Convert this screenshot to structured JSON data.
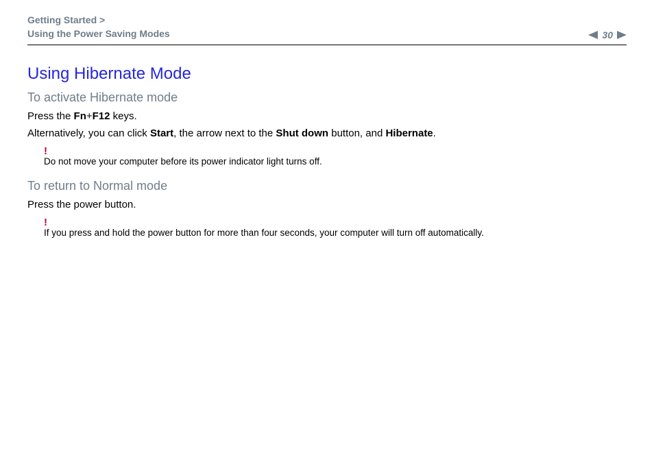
{
  "header": {
    "breadcrumb_line1": "Getting Started >",
    "breadcrumb_line2": "Using the Power Saving Modes",
    "page_number": "30"
  },
  "content": {
    "title": "Using Hibernate Mode",
    "section1_heading": "To activate Hibernate mode",
    "p1_pre": "Press the ",
    "p1_b1": "Fn",
    "p1_mid": "+",
    "p1_b2": "F12",
    "p1_post": " keys.",
    "p2_pre": "Alternatively, you can click ",
    "p2_b1": "Start",
    "p2_mid1": ", the arrow next to the ",
    "p2_b2": "Shut down",
    "p2_mid2": " button, and ",
    "p2_b3": "Hibernate",
    "p2_post": ".",
    "note1_mark": "!",
    "note1_text": "Do not move your computer before its power indicator light turns off.",
    "section2_heading": "To return to Normal mode",
    "p3": "Press the power button.",
    "note2_mark": "!",
    "note2_text": "If you press and hold the power button for more than four seconds, your computer will turn off automatically."
  }
}
